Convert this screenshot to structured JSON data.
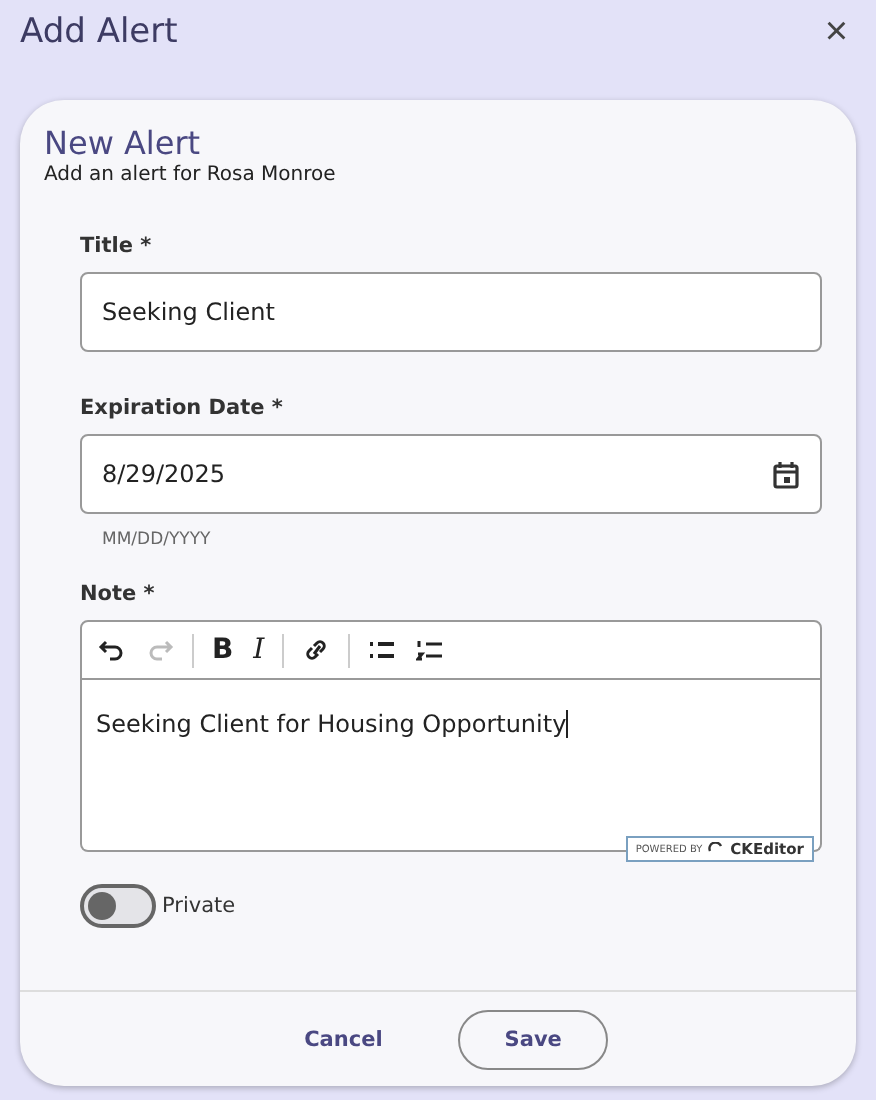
{
  "dialog": {
    "title": "Add Alert",
    "close": "×"
  },
  "card": {
    "title": "New Alert",
    "subtitle": "Add an alert for Rosa Monroe"
  },
  "title_field": {
    "label": "Title *",
    "value": "Seeking Client"
  },
  "date_field": {
    "label": "Expiration Date *",
    "value": "8/29/2025",
    "helper": "MM/DD/YYYY"
  },
  "note": {
    "label": "Note *",
    "toolbar": [
      {
        "kind": "undo",
        "disabled": false
      },
      {
        "kind": "redo",
        "disabled": true
      },
      {
        "kind": "bold",
        "label": "B",
        "disabled": false
      },
      {
        "kind": "italic",
        "label": "I",
        "disabled": false
      },
      {
        "kind": "link",
        "disabled": false
      },
      {
        "kind": "bullets",
        "disabled": false
      },
      {
        "kind": "numbers",
        "disabled": false
      }
    ],
    "value": "Seeking Client for Housing Opportunity",
    "badge": {
      "prefix": "POWERED BY",
      "brand": "CKEditor"
    }
  },
  "private": {
    "label": "Private",
    "on": false
  },
  "buttons": [
    {
      "kind": "text",
      "label": "Cancel"
    },
    {
      "kind": "outlined",
      "label": "Save"
    }
  ]
}
